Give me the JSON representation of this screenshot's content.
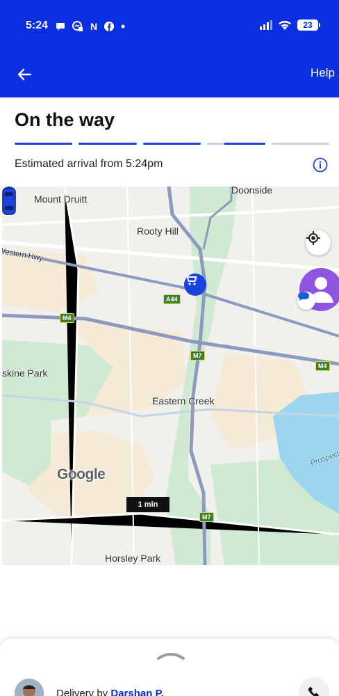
{
  "status_bar": {
    "time": "5:24",
    "notification_icons": [
      "chat-bubble-icon",
      "messenger-icon",
      "n-app-icon",
      "facebook-icon",
      "dot-icon"
    ],
    "battery_level": "23"
  },
  "app_bar": {
    "help_label": "Help",
    "background_color": "#0a2fe0"
  },
  "order_status": {
    "title": "On the way",
    "eta_text": "Estimated arrival from 5:24pm",
    "progress_segments_total": 5,
    "progress_segments_complete": 4,
    "progress_accent": "#1b43e2"
  },
  "map": {
    "places": [
      "Doonside",
      "Mount Druitt",
      "Rooty Hill",
      "Western Hwy",
      "skine Park",
      "Eastern Creek",
      "Prospect",
      "Horsley Park"
    ],
    "road_badges": [
      "A44",
      "M4",
      "M7",
      "M7",
      "M4",
      "M7"
    ],
    "attribution": "Google",
    "eta_badge": "1 min"
  },
  "bottom_sheet": {
    "delivery_prefix": "Delivery by",
    "driver_name": "Darshan P."
  }
}
